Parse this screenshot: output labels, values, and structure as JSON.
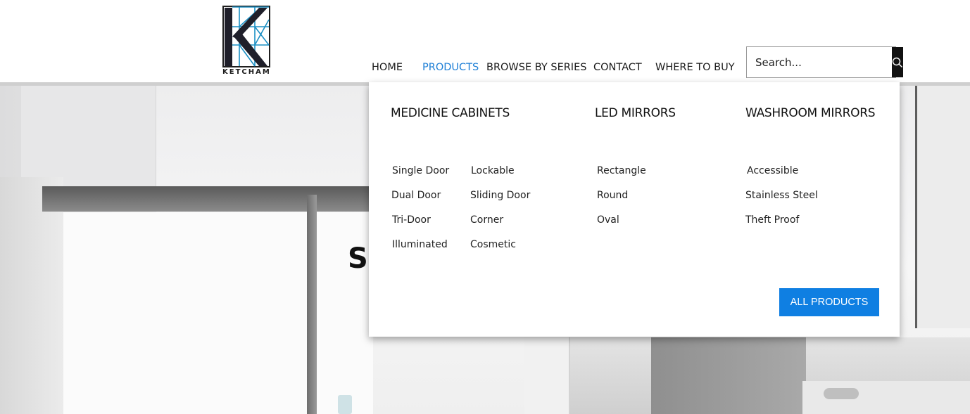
{
  "brand": {
    "name": "KETCHAM"
  },
  "nav": {
    "items": [
      {
        "label": "HOME"
      },
      {
        "label": "PRODUCTS",
        "active": true
      },
      {
        "label": "BROWSE BY SERIES"
      },
      {
        "label": "CONTACT"
      },
      {
        "label": "WHERE TO BUY"
      }
    ],
    "active_color": "#1e7fd6"
  },
  "search": {
    "placeholder": "Search...",
    "icon": "search-icon"
  },
  "hero": {
    "visible_text": "S"
  },
  "dropdown": {
    "columns": [
      {
        "title": "MEDICINE CABINETS",
        "links_col1": [
          "Single Door",
          "Dual Door",
          "Tri-Door",
          "Illuminated"
        ],
        "links_col2": [
          "Lockable",
          "Sliding Door",
          "Corner",
          "Cosmetic"
        ]
      },
      {
        "title": "LED MIRRORS",
        "links": [
          "Rectangle",
          "Round",
          "Oval"
        ]
      },
      {
        "title": "WASHROOM MIRRORS",
        "links": [
          "Accessible",
          "Stainless Steel",
          "Theft Proof"
        ]
      }
    ],
    "all_products_label": "ALL PRODUCTS",
    "button_color": "#0f7fe2"
  }
}
